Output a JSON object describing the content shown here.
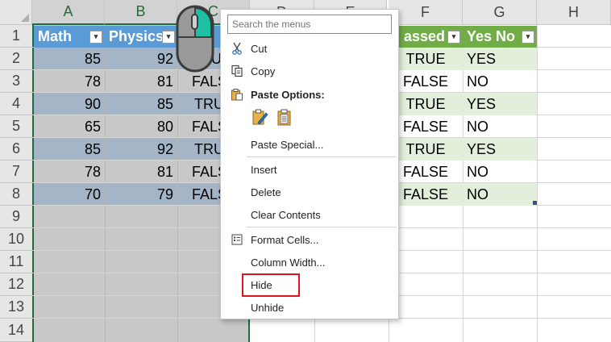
{
  "columns": [
    "A",
    "B",
    "C",
    "D",
    "E",
    "F",
    "G",
    "H"
  ],
  "rows": [
    "1",
    "2",
    "3",
    "4",
    "5",
    "6",
    "7",
    "8",
    "9",
    "10",
    "11",
    "12",
    "13",
    "14"
  ],
  "headers": {
    "math": "Math",
    "physics": "Physics",
    "passed": "assed",
    "yesno": "Yes No"
  },
  "data": {
    "math": [
      "85",
      "78",
      "90",
      "65",
      "85",
      "78",
      "70"
    ],
    "physics": [
      "92",
      "81",
      "85",
      "80",
      "92",
      "81",
      "79"
    ],
    "c": [
      "TRU",
      "FALS",
      "TRU",
      "FALS",
      "TRU",
      "FALS",
      "FALS"
    ],
    "passed": [
      "TRUE",
      "FALSE",
      "TRUE",
      "FALSE",
      "TRUE",
      "FALSE",
      "FALSE"
    ],
    "yesno": [
      "YES",
      "NO",
      "YES",
      "NO",
      "YES",
      "NO",
      "NO"
    ]
  },
  "context_menu": {
    "search_placeholder": "Search the menus",
    "cut": "Cut",
    "copy": "Copy",
    "paste_options": "Paste Options:",
    "paste_special": "Paste Special...",
    "insert": "Insert",
    "delete": "Delete",
    "clear_contents": "Clear Contents",
    "format_cells": "Format Cells...",
    "column_width": "Column Width...",
    "hide": "Hide",
    "unhide": "Unhide"
  },
  "colors": {
    "blue_header": "#5b9bd5",
    "green_header": "#70ad47",
    "selection_gray": "#c8c8c8",
    "selection_blue": "#a4b5c8",
    "green_band": "#e2efda",
    "highlight_red": "#e0141e",
    "mouse_teal": "#1fbfa4"
  },
  "icons": [
    "scissors-icon",
    "copy-icon",
    "paste-icon",
    "paste-format-icon",
    "paste-values-icon",
    "format-cells-icon",
    "mouse-icon",
    "filter-dropdown-icon"
  ]
}
